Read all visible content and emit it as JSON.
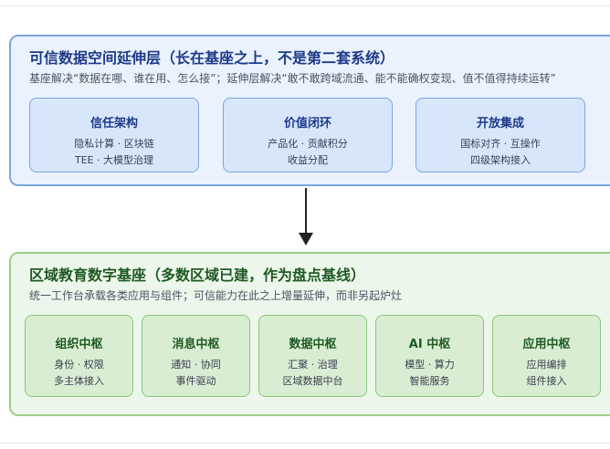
{
  "trust_layer": {
    "title": "可信数据空间延伸层（长在基座之上，不是第二套系统）",
    "subtitle": "基座解决“数据在哪、谁在用、怎么接”；延伸层解决“敢不敢跨域流通、能不能确权变现、值不值得持续运转”",
    "cards": [
      {
        "title": "信任架构",
        "lines": [
          "隐私计算 · 区块链",
          "TEE · 大模型治理"
        ]
      },
      {
        "title": "价值闭环",
        "lines": [
          "产品化 · 贡献积分",
          "收益分配"
        ]
      },
      {
        "title": "开放集成",
        "lines": [
          "国标对齐 · 互操作",
          "四级架构接入"
        ]
      }
    ]
  },
  "base_layer": {
    "title": "区域教育数字基座（多数区域已建，作为盘点基线）",
    "subtitle": "统一工作台承载各类应用与组件；可信能力在此之上增量延伸，而非另起炉灶",
    "cards": [
      {
        "title": "组织中枢",
        "lines": [
          "身份 · 权限",
          "多主体接入"
        ]
      },
      {
        "title": "消息中枢",
        "lines": [
          "通知 · 协同",
          "事件驱动"
        ]
      },
      {
        "title": "数据中枢",
        "lines": [
          "汇聚 · 治理",
          "区域数据中台"
        ]
      },
      {
        "title": "AI 中枢",
        "lines": [
          "模型 · 算力",
          "智能服务"
        ]
      },
      {
        "title": "应用中枢",
        "lines": [
          "应用编排",
          "组件接入"
        ]
      }
    ]
  },
  "colors": {
    "blue_border": "#7aa6e3",
    "blue_fill": "#eaf2fd",
    "green_border": "#9ccd8d",
    "green_fill": "#edf6ea",
    "arrow": "#222222"
  }
}
